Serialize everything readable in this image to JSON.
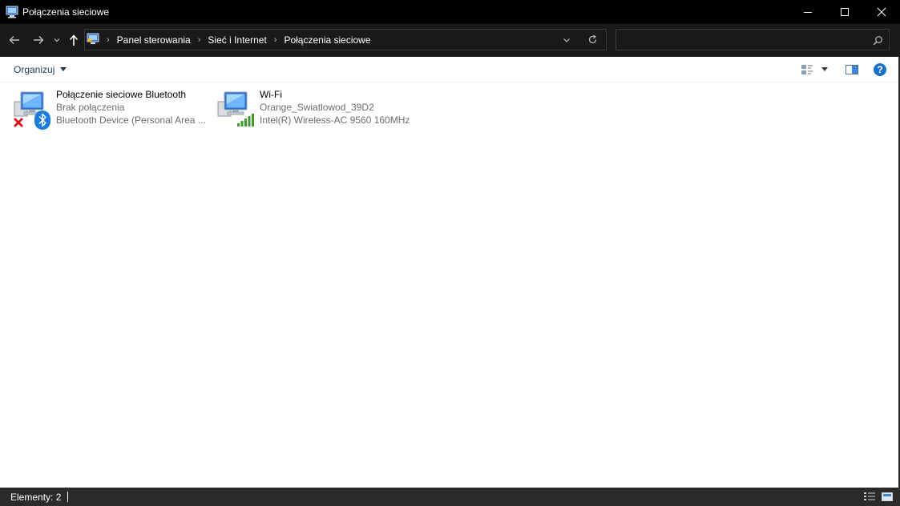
{
  "window": {
    "title": "Połączenia sieciowe",
    "icon": "network-connections-icon"
  },
  "address": {
    "breadcrumbs": [
      "Panel sterowania",
      "Sieć i Internet",
      "Połączenia sieciowe"
    ]
  },
  "search": {
    "value": "",
    "placeholder": ""
  },
  "toolbar": {
    "organize_label": "Organizuj"
  },
  "items": [
    {
      "name": "Połączenie sieciowe Bluetooth",
      "status": "Brak połączenia",
      "device": "Bluetooth Device (Personal Area ...",
      "icon": "network-computer-icon",
      "overlay_icons": [
        "error-x-icon",
        "bluetooth-icon"
      ]
    },
    {
      "name": "Wi-Fi",
      "status": "Orange_Swiatlowod_39D2",
      "device": "Intel(R) Wireless-AC 9560 160MHz",
      "icon": "network-computer-icon",
      "overlay_icons": [
        "wifi-signal-icon"
      ]
    }
  ],
  "status": {
    "items_count": "Elementy: 2"
  },
  "colors": {
    "titlebar_bg": "#000000",
    "addressbar_bg": "#191919",
    "statusbar_bg": "#2b2b2b",
    "toolbar_text": "#1e395b",
    "help_blue": "#1a73c8",
    "signal_green": "#3e9a2a",
    "error_red": "#d01c1c"
  }
}
